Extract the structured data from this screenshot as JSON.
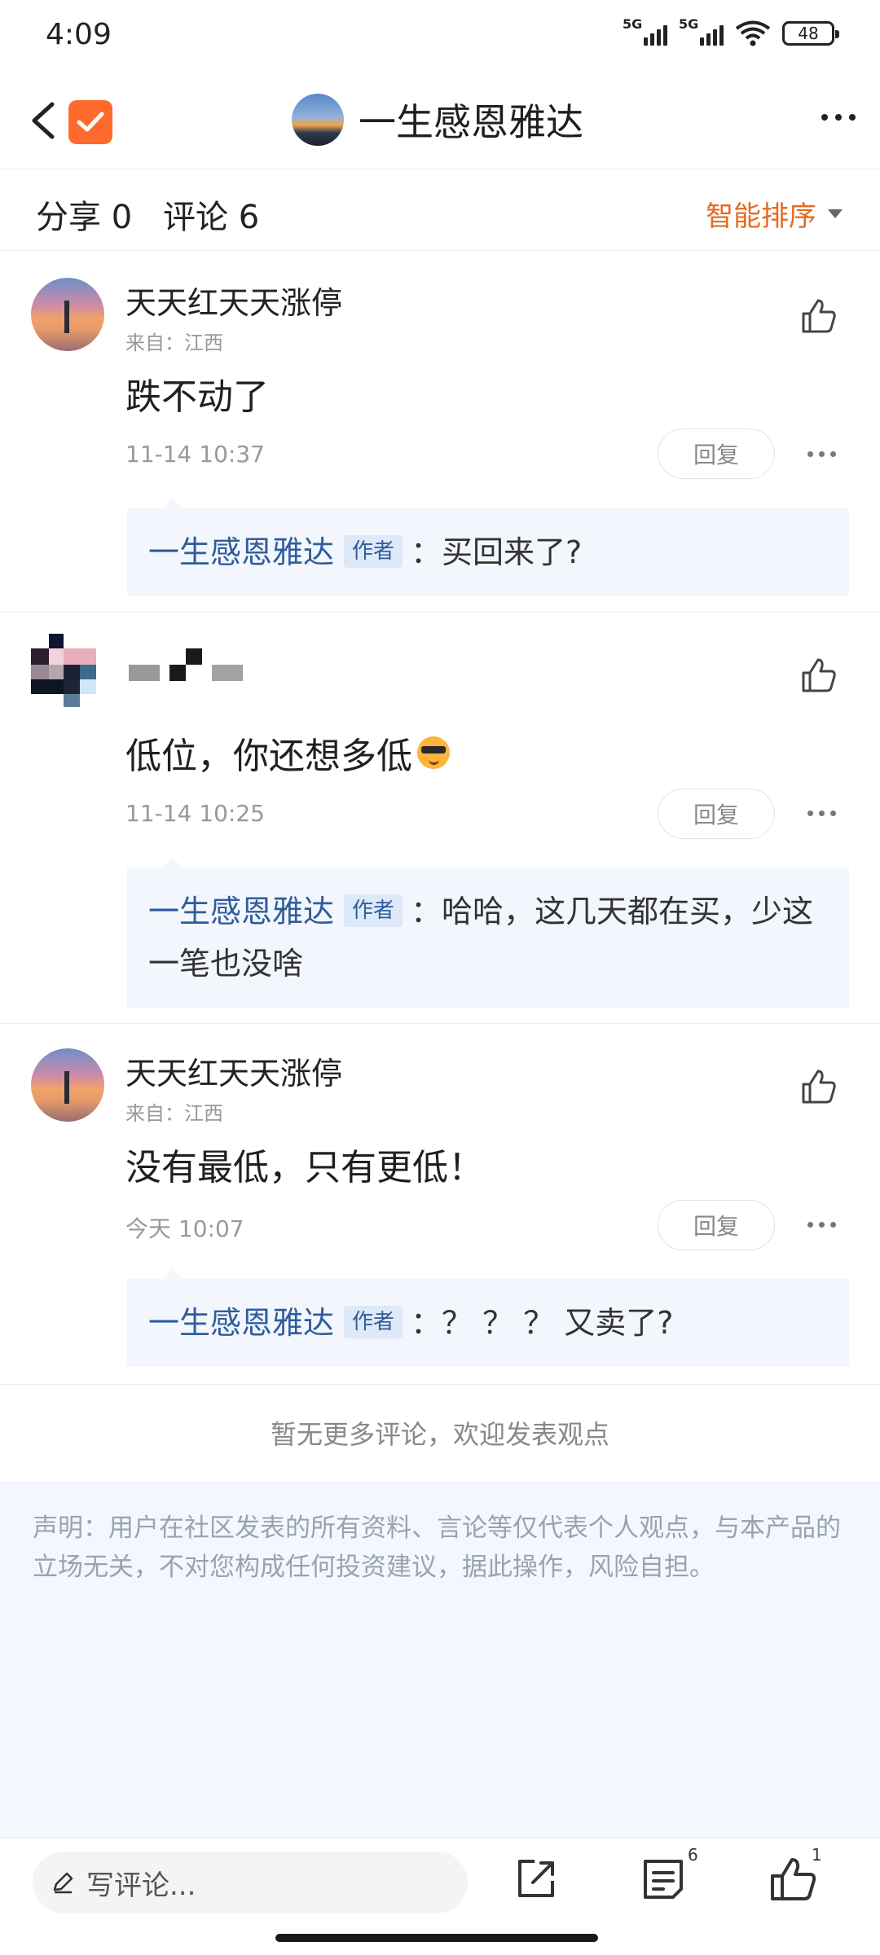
{
  "status_bar": {
    "time": "4:09",
    "network1": "5G",
    "network2": "5G",
    "battery": "48"
  },
  "header": {
    "title": "一生感恩雅达"
  },
  "stats": {
    "share_label": "分享 0",
    "comment_label": "评论 6",
    "sort_label": "智能排序"
  },
  "comments": [
    {
      "username": "天天红天天涨停",
      "location": "来自：江西",
      "content": "跌不动了",
      "time": "11-14 10:37",
      "reply_label": "回复",
      "reply": {
        "author": "一生感恩雅达",
        "author_tag": "作者",
        "text": "：买回来了?"
      }
    },
    {
      "username": "",
      "location": "",
      "content": "低位，你还想多低",
      "time": "11-14 10:25",
      "reply_label": "回复",
      "reply": {
        "author": "一生感恩雅达",
        "author_tag": "作者",
        "text": "：哈哈，这几天都在买，少这一笔也没啥"
      }
    },
    {
      "username": "天天红天天涨停",
      "location": "来自：江西",
      "content": "没有最低，只有更低！",
      "time": "今天 10:07",
      "reply_label": "回复",
      "reply": {
        "author": "一生感恩雅达",
        "author_tag": "作者",
        "text": "：？ ？ ？ 又卖了?"
      }
    }
  ],
  "footer": {
    "no_more": "暂无更多评论，欢迎发表观点",
    "disclaimer": "声明：用户在社区发表的所有资料、言论等仅代表个人观点，与本产品的立场无关，不对您构成任何投资建议，据此操作，风险自担。"
  },
  "bottom_bar": {
    "comment_placeholder": "写评论...",
    "comment_count": "6",
    "like_count": "1"
  },
  "colors": {
    "accent": "#e56a1f",
    "reply_bg": "#f3f7fd",
    "author_blue": "#2f5d9b",
    "app_badge": "#fe6a2b"
  }
}
